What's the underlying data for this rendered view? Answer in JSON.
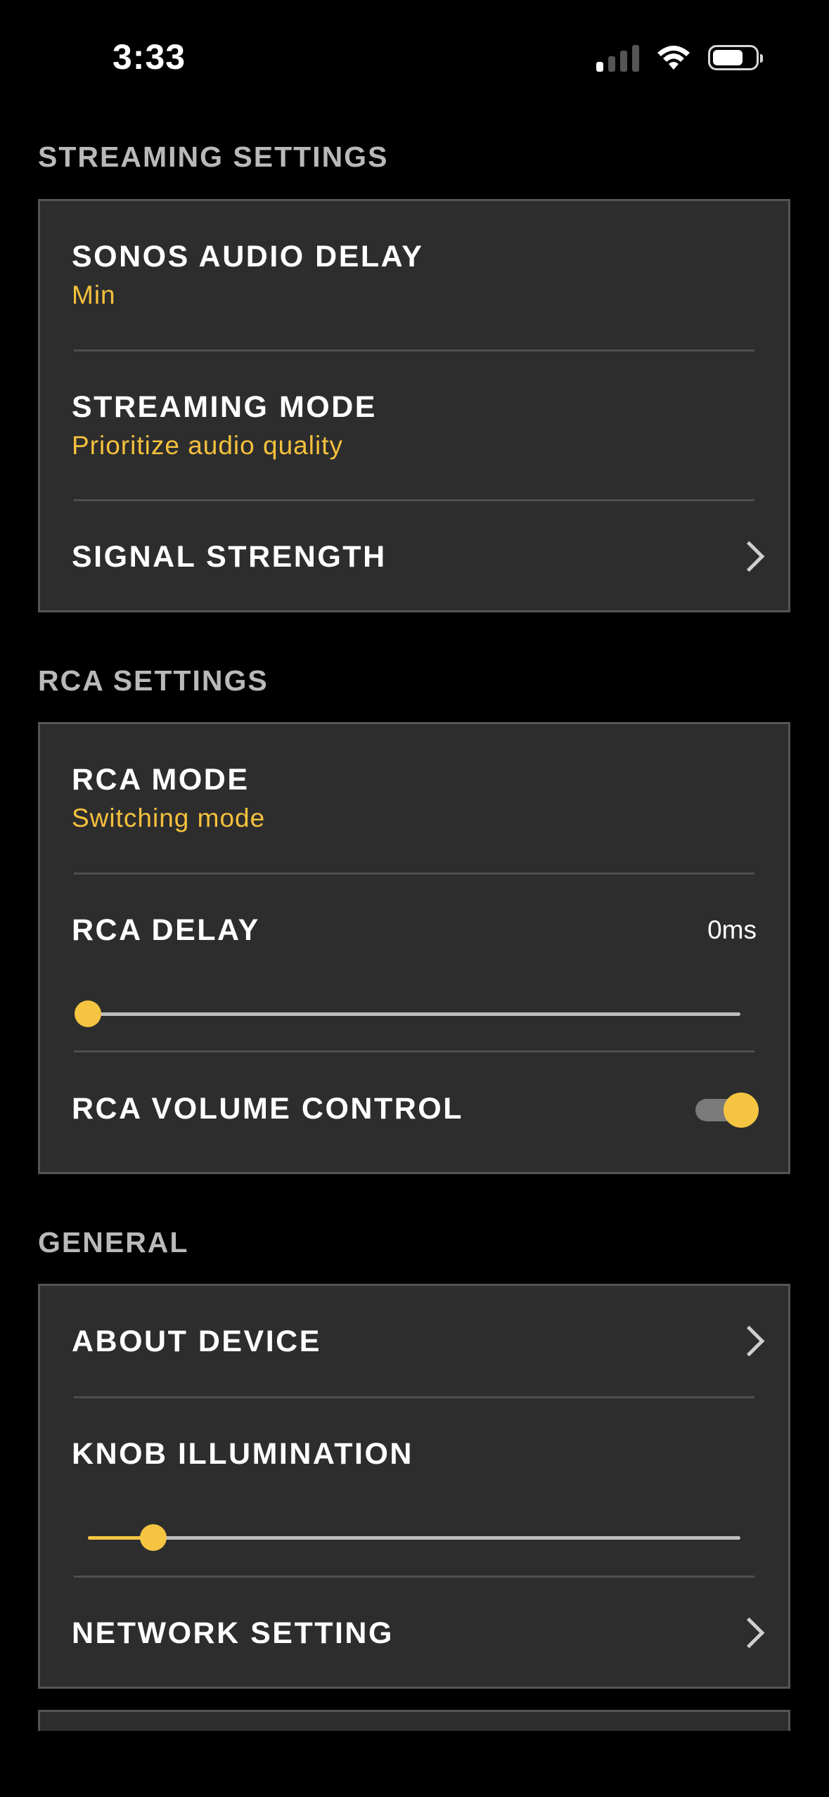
{
  "status_bar": {
    "time": "3:33",
    "signal_bars": 1,
    "battery_level": 0.7
  },
  "streaming": {
    "header": "STREAMING SETTINGS",
    "audio_delay": {
      "label": "SONOS AUDIO DELAY",
      "value": "Min"
    },
    "mode": {
      "label": "STREAMING MODE",
      "value": "Prioritize audio quality"
    },
    "signal": {
      "label": "SIGNAL STRENGTH"
    }
  },
  "rca": {
    "header": "RCA SETTINGS",
    "mode": {
      "label": "RCA MODE",
      "value": "Switching mode"
    },
    "delay": {
      "label": "RCA DELAY",
      "value": "0ms",
      "slider_fraction": 0
    },
    "volume_control": {
      "label": "RCA VOLUME CONTROL",
      "enabled": true
    }
  },
  "general": {
    "header": "GENERAL",
    "about": {
      "label": "ABOUT DEVICE"
    },
    "knob": {
      "label": "KNOB ILLUMINATION",
      "slider_fraction": 0.1
    },
    "network": {
      "label": "NETWORK SETTING"
    }
  },
  "colors": {
    "accent": "#f5c542",
    "card_bg": "#2d2d2d",
    "subtitle": "#f5c13d"
  }
}
